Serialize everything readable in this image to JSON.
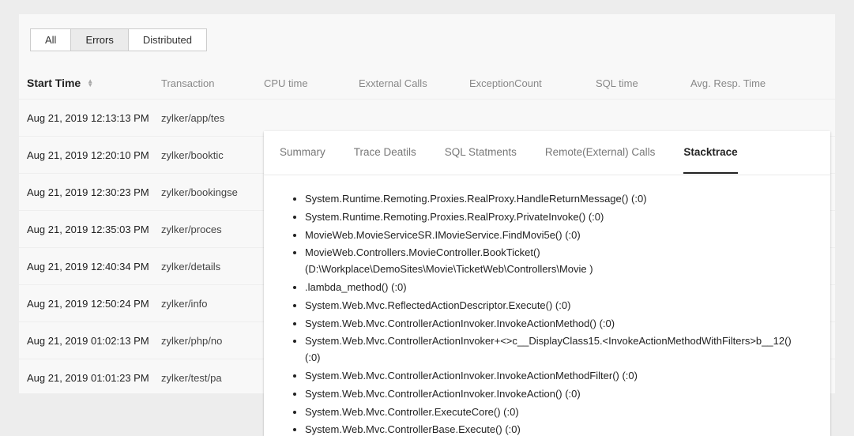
{
  "filters": {
    "all": "All",
    "errors": "Errors",
    "distributed": "Distributed",
    "active": "errors"
  },
  "columns": {
    "start_time": "Start Time",
    "transaction": "Transaction",
    "cpu_time": "CPU time",
    "external_calls": "Exxternal Calls",
    "exception_count": "ExceptionCount",
    "sql_time": "SQL time",
    "avg_resp_time": "Avg. Resp. Time"
  },
  "rows": [
    {
      "time": "Aug 21, 2019 12:13:13 PM",
      "txn": "zylker/app/tes"
    },
    {
      "time": "Aug 21, 2019 12:20:10 PM",
      "txn": "zylker/booktic"
    },
    {
      "time": "Aug 21, 2019 12:30:23 PM",
      "txn": "zylker/bookingse"
    },
    {
      "time": "Aug 21, 2019 12:35:03 PM",
      "txn": "zylker/proces"
    },
    {
      "time": "Aug 21, 2019 12:40:34 PM",
      "txn": "zylker/details"
    },
    {
      "time": "Aug 21, 2019 12:50:24 PM",
      "txn": "zylker/info"
    },
    {
      "time": "Aug 21, 2019 01:02:13 PM",
      "txn": "zylker/php/no"
    },
    {
      "time": "Aug 21, 2019 01:01:23 PM",
      "txn": "zylker/test/pa"
    }
  ],
  "popup": {
    "tabs": {
      "summary": "Summary",
      "trace_details": "Trace Deatils",
      "sql_statements": "SQL Statments",
      "remote_calls": "Remote(External) Calls",
      "stacktrace": "Stacktrace"
    },
    "active_tab": "stacktrace",
    "stacktrace": [
      "System.Runtime.Remoting.Proxies.RealProxy.HandleReturnMessage() (:0)",
      "System.Runtime.Remoting.Proxies.RealProxy.PrivateInvoke() (:0)",
      "MovieWeb.MovieServiceSR.IMovieService.FindMovi5e() (:0)",
      "MovieWeb.Controllers.MovieController.BookTicket() (D:\\Workplace\\DemoSites\\Movie\\TicketWeb\\Controllers\\Movie )",
      ".lambda_method() (:0)",
      "System.Web.Mvc.ReflectedActionDescriptor.Execute() (:0)",
      "System.Web.Mvc.ControllerActionInvoker.InvokeActionMethod() (:0)",
      "System.Web.Mvc.ControllerActionInvoker+<>c__DisplayClass15.<InvokeActionMethodWithFilters>b__12() (:0)",
      "System.Web.Mvc.ControllerActionInvoker.InvokeActionMethodFilter() (:0)",
      "System.Web.Mvc.ControllerActionInvoker.InvokeAction() (:0)",
      "System.Web.Mvc.Controller.ExecuteCore() (:0)",
      "System.Web.Mvc.ControllerBase.Execute() (:0)"
    ]
  }
}
